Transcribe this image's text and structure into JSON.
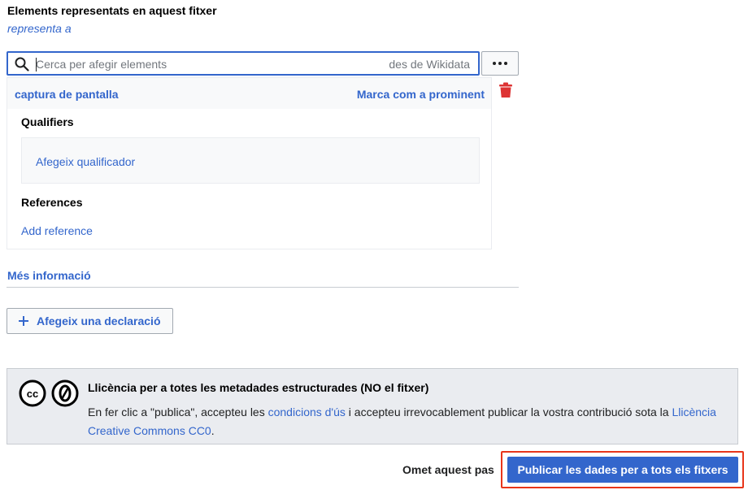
{
  "section": {
    "title": "Elements representats en aquest fitxer",
    "property": "representa a"
  },
  "search": {
    "placeholder": "Cerca per afegir elements",
    "value": "",
    "suffix": "des de Wikidata"
  },
  "statement": {
    "value_label": "captura de pantalla",
    "prominent_link": "Marca com a prominent",
    "qualifiers_title": "Qualifiers",
    "add_qualifier": "Afegeix qualificador",
    "references_title": "References",
    "add_reference": "Add reference"
  },
  "more_info": "Més informació",
  "add_statement": "Afegeix una declaració",
  "license": {
    "title": "Llicència per a totes les metadades estructurades (NO el fitxer)",
    "text_before": "En fer clic a \"publica\", accepteu les ",
    "terms_link": "condicions d'ús",
    "text_middle": " i accepteu irrevocablement publicar la vostra contribució sota la ",
    "license_link": "Llicència Creative Commons CC0",
    "text_after": ".",
    "cc_icon_text": "cc",
    "zero_icon_text": "0"
  },
  "footer": {
    "skip_label": "Omet aquest pas",
    "publish_label": "Publicar les dades per a tots els fitxers"
  },
  "colors": {
    "accent": "#3366cc",
    "delete": "#d33",
    "highlight": "#e8351a"
  },
  "icons": [
    "search-icon",
    "more-icon",
    "trash-icon",
    "plus-icon",
    "cc-icon",
    "cc-zero-icon"
  ]
}
